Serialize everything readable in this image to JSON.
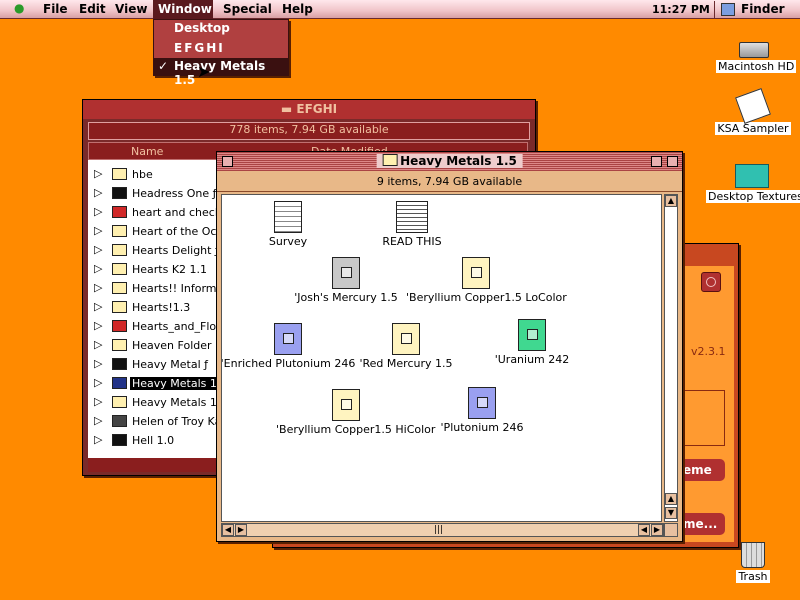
{
  "menubar": {
    "apple": "",
    "items": [
      "File",
      "Edit",
      "View",
      "Window",
      "Special",
      "Help"
    ],
    "clock": "11:27 PM",
    "app": "Finder"
  },
  "window_menu": {
    "items": [
      "Desktop",
      "EFGHI",
      "Heavy Metals 1.5"
    ],
    "checked": "✓"
  },
  "efghi": {
    "title": "EFGHI",
    "info": "778 items, 7.94 GB available",
    "columns": [
      "Name",
      "Date Modified"
    ],
    "rows": [
      {
        "name": "hbe",
        "icon": "folder-icon"
      },
      {
        "name": "Headress One ƒ",
        "icon": "folder-icon"
      },
      {
        "name": "heart and check1.",
        "icon": "document-icon"
      },
      {
        "name": "Heart of the Ocean",
        "icon": "folder-icon"
      },
      {
        "name": "Hearts Delight ƒ",
        "icon": "folder-icon"
      },
      {
        "name": "Hearts K2 1.1",
        "icon": "folder-icon"
      },
      {
        "name": "Hearts!! Informati",
        "icon": "folder-icon"
      },
      {
        "name": "Hearts!1.3",
        "icon": "folder-icon"
      },
      {
        "name": "Hearts_and_Flowe",
        "icon": "document-icon"
      },
      {
        "name": "Heaven Folder",
        "icon": "folder-icon"
      },
      {
        "name": "Heavy Metal ƒ",
        "icon": "folder-icon"
      },
      {
        "name": "Heavy Metals 1.5",
        "icon": "folder-icon"
      },
      {
        "name": "Heavy Metals 1.5",
        "icon": "folder-icon"
      },
      {
        "name": "Helen of Troy Kal.",
        "icon": "picture-icon"
      },
      {
        "name": "Hell 1.0",
        "icon": "folder-icon"
      }
    ]
  },
  "back_window": {
    "version": "v2.3.1",
    "button1": "eme",
    "button2": "me..."
  },
  "heavy_metals": {
    "title": "Heavy Metals 1.5",
    "info": "9 items, 7.94 GB available",
    "items": [
      {
        "name": "Survey",
        "icon": "text-document-icon"
      },
      {
        "name": "READ THIS",
        "icon": "readme-document-icon"
      },
      {
        "name": "'Josh's Mercury 1.5",
        "icon": "grey-document-icon"
      },
      {
        "name": "'Beryllium Copper1.5 LoColor",
        "icon": "cream-document-icon"
      },
      {
        "name": "'Enriched Plutonium 246",
        "icon": "blue-document-icon"
      },
      {
        "name": "'Red Mercury 1.5",
        "icon": "cream-document-icon"
      },
      {
        "name": "'Uranium 242",
        "icon": "green-document-icon"
      },
      {
        "name": "'Beryllium Copper1.5 HiColor",
        "icon": "cream-document-icon"
      },
      {
        "name": "'Plutonium 246",
        "icon": "blue-document-icon"
      }
    ]
  },
  "desktop": {
    "icons": [
      "Macintosh HD",
      "KSA Sampler",
      "Desktop Textures",
      "Trash"
    ]
  },
  "colors": {
    "desktop": "#ff8a00",
    "window_accent": "#b03030",
    "selection": "#3a1010"
  }
}
